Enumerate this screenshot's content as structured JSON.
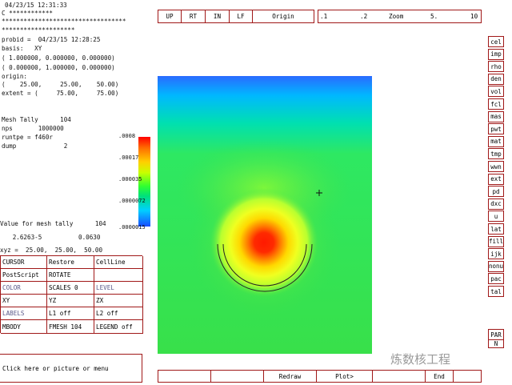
{
  "header": {
    "timestamp": "04/23/15 12:31:33",
    "comment_line": "C ************",
    "star_line1": "**********************************",
    "star_line2": "********************"
  },
  "info": {
    "probid": "probid =  04/23/15 12:28:25",
    "basis": "basis:   XY",
    "basis_v1": "( 1.000000, 0.000000, 0.000000)",
    "basis_v2": "( 0.000000, 1.000000, 0.000000)",
    "origin_label": "origin:",
    "origin_values": "(    25.00,     25.00,    50.00)",
    "extent": "extent = (     75.00,     75.00)"
  },
  "tally": {
    "mesh_tally": "Mesh Tally      104",
    "nps": "nps       1000000",
    "runtpe": "runtpe = f460r",
    "dump": "dump             2"
  },
  "value_panel": {
    "title": "Value for mesh tally      104",
    "value": "   2.6263-5          0.0630",
    "xyz": "xyz =  25.00,  25.00,  50.00"
  },
  "colorbar": {
    "labels": [
      ".0008",
      ".00017",
      ".000035",
      ".0000072",
      ".0000015"
    ]
  },
  "top_toolbar": {
    "up": "UP",
    "rt": "RT",
    "in": "IN",
    "lf": "LF",
    "origin": "Origin",
    "z1": ".1",
    "z2": ".2",
    "zoom": "Zoom",
    "z5": "5.",
    "z10": "10"
  },
  "left_menu": [
    [
      "CURSOR",
      "Restore",
      "CellLine"
    ],
    [
      "PostScript",
      "ROTATE",
      ""
    ],
    [
      "COLOR",
      "SCALES 0",
      "LEVEL"
    ],
    [
      "XY",
      "YZ",
      "ZX"
    ],
    [
      "LABELS",
      "L1 off",
      "L2 off"
    ],
    [
      "MBODY",
      "FMESH  104",
      "LEGEND off"
    ]
  ],
  "prompt": "Click here or picture or menu",
  "right_menu": [
    "cel",
    "imp",
    "rho",
    "den",
    "vol",
    "fcl",
    "mas",
    "pwt",
    "mat",
    "tmp",
    "wwn",
    "ext",
    "pd",
    "dxc",
    "u",
    "lat",
    "fill",
    "ijk",
    "nonu",
    "pac",
    "tal"
  ],
  "right_bottom": [
    "PAR",
    "N"
  ],
  "bottom_bar": {
    "redraw": "Redraw",
    "plot": "Plot>",
    "end": "End"
  },
  "watermark": "炼数核工程",
  "colors": {
    "frame": "#a01818",
    "background": "#ffffff"
  }
}
